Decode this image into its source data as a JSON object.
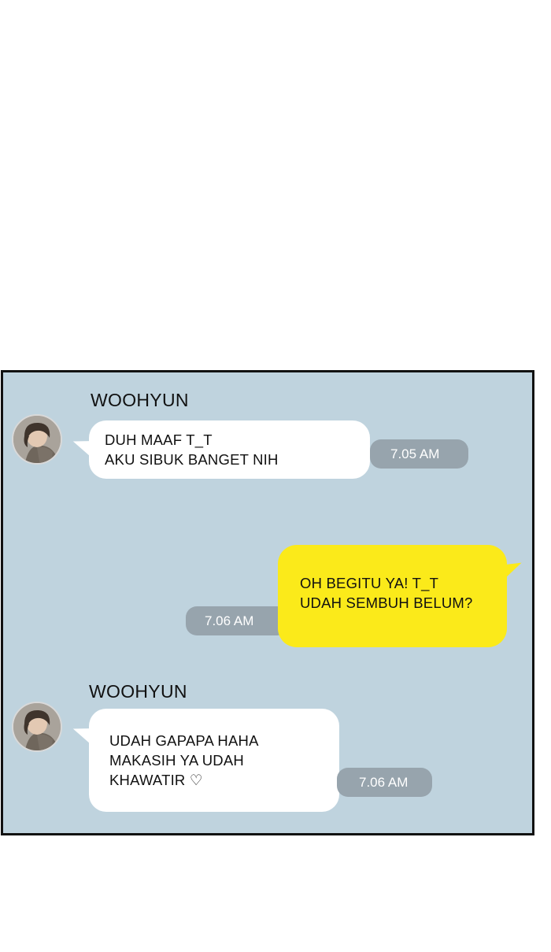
{
  "messages": [
    {
      "sender": "WOOHYUN",
      "lines": [
        "DUH MAAF T_T",
        "AKU SIBUK BANGET NIH"
      ],
      "time": "7.05 AM"
    },
    {
      "sender": "",
      "lines": [
        "OH BEGITU YA! T_T",
        "UDAH SEMBUH BELUM?"
      ],
      "time": "7.06 AM"
    },
    {
      "sender": "WOOHYUN",
      "lines": [
        "UDAH GAPAPA HAHA",
        "MAKASIH YA UDAH",
        "KHAWATIR ♡"
      ],
      "time": "7.06 AM"
    }
  ],
  "colors": {
    "chat_background": "#bfd3de",
    "outgoing_bubble": "#fbea1a",
    "incoming_bubble": "#ffffff",
    "timestamp_pill": "#97a4ad"
  },
  "icons": {
    "avatar": "woohyun-profile-picture"
  }
}
